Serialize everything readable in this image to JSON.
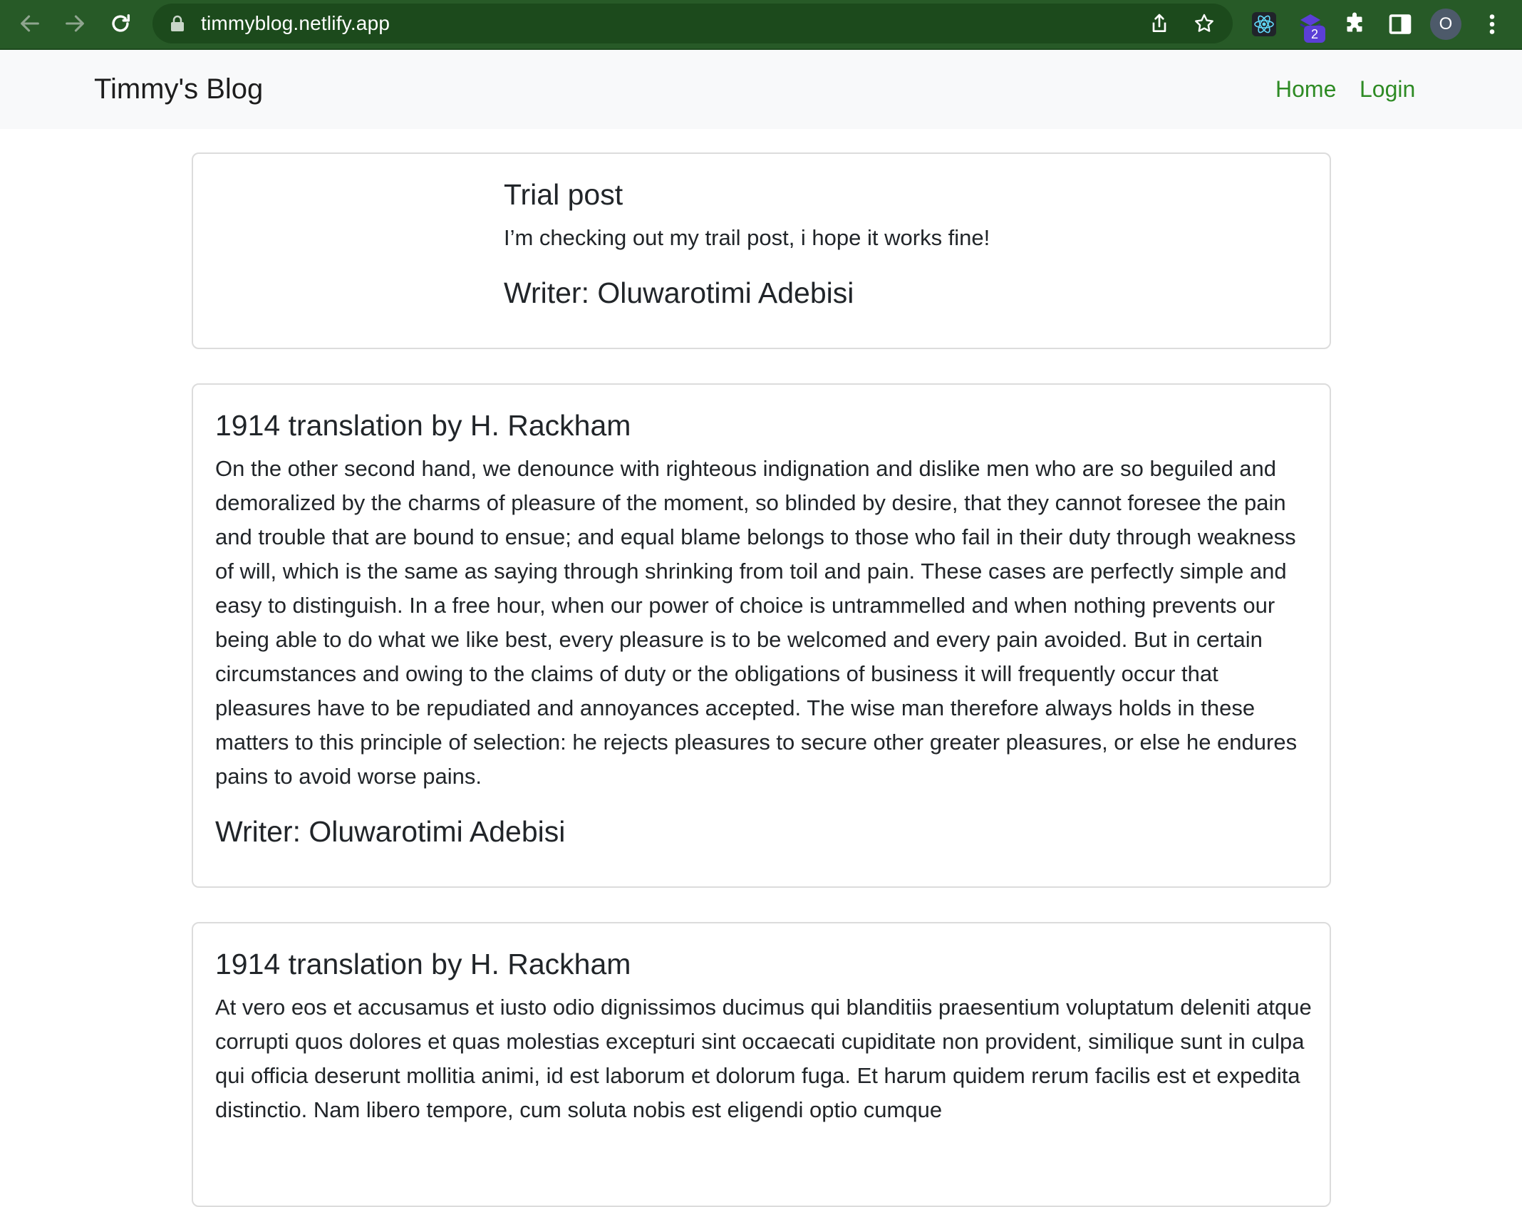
{
  "browser": {
    "url": "timmyblog.netlify.app",
    "extension_badge": "2",
    "profile_initial": "O"
  },
  "site": {
    "brand": "Timmy's Blog",
    "nav": [
      {
        "label": "Home"
      },
      {
        "label": "Login"
      }
    ]
  },
  "posts": [
    {
      "title": "Trial post",
      "body": "I’m checking out my trail post, i hope it works fine!",
      "author": "Writer: Oluwarotimi Adebisi"
    },
    {
      "title": "1914 translation by H. Rackham",
      "body": "On the other second hand, we denounce with righteous indignation and dislike men who are so beguiled and demoralized by the charms of pleasure of the moment, so blinded by desire, that they cannot foresee the pain and trouble that are bound to ensue; and equal blame belongs to those who fail in their duty through weakness of will, which is the same as saying through shrinking from toil and pain. These cases are perfectly simple and easy to distinguish. In a free hour, when our power of choice is untrammelled and when nothing prevents our being able to do what we like best, every pleasure is to be welcomed and every pain avoided. But in certain circumstances and owing to the claims of duty or the obligations of business it will frequently occur that pleasures have to be repudiated and annoyances accepted. The wise man therefore always holds in these matters to this principle of selection: he rejects pleasures to secure other greater pleasures, or else he endures pains to avoid worse pains.",
      "author": "Writer: Oluwarotimi Adebisi"
    },
    {
      "title": "1914 translation by H. Rackham",
      "body": "At vero eos et accusamus et iusto odio dignissimos ducimus qui blanditiis praesentium voluptatum deleniti atque corrupti quos dolores et quas molestias excepturi sint occaecati cupiditate non provident, similique sunt in culpa qui officia deserunt mollitia animi, id est laborum et dolorum fuga. Et harum quidem rerum facilis est et expedita distinctio. Nam libero tempore, cum soluta nobis est eligendi optio cumque"
    }
  ],
  "colors": {
    "chrome_bg": "#275a27",
    "omnibox_bg": "#1c4a1c",
    "navbar_bg": "#f8f9fa",
    "link": "#2e8b24",
    "card_border": "#dcdcdc"
  }
}
